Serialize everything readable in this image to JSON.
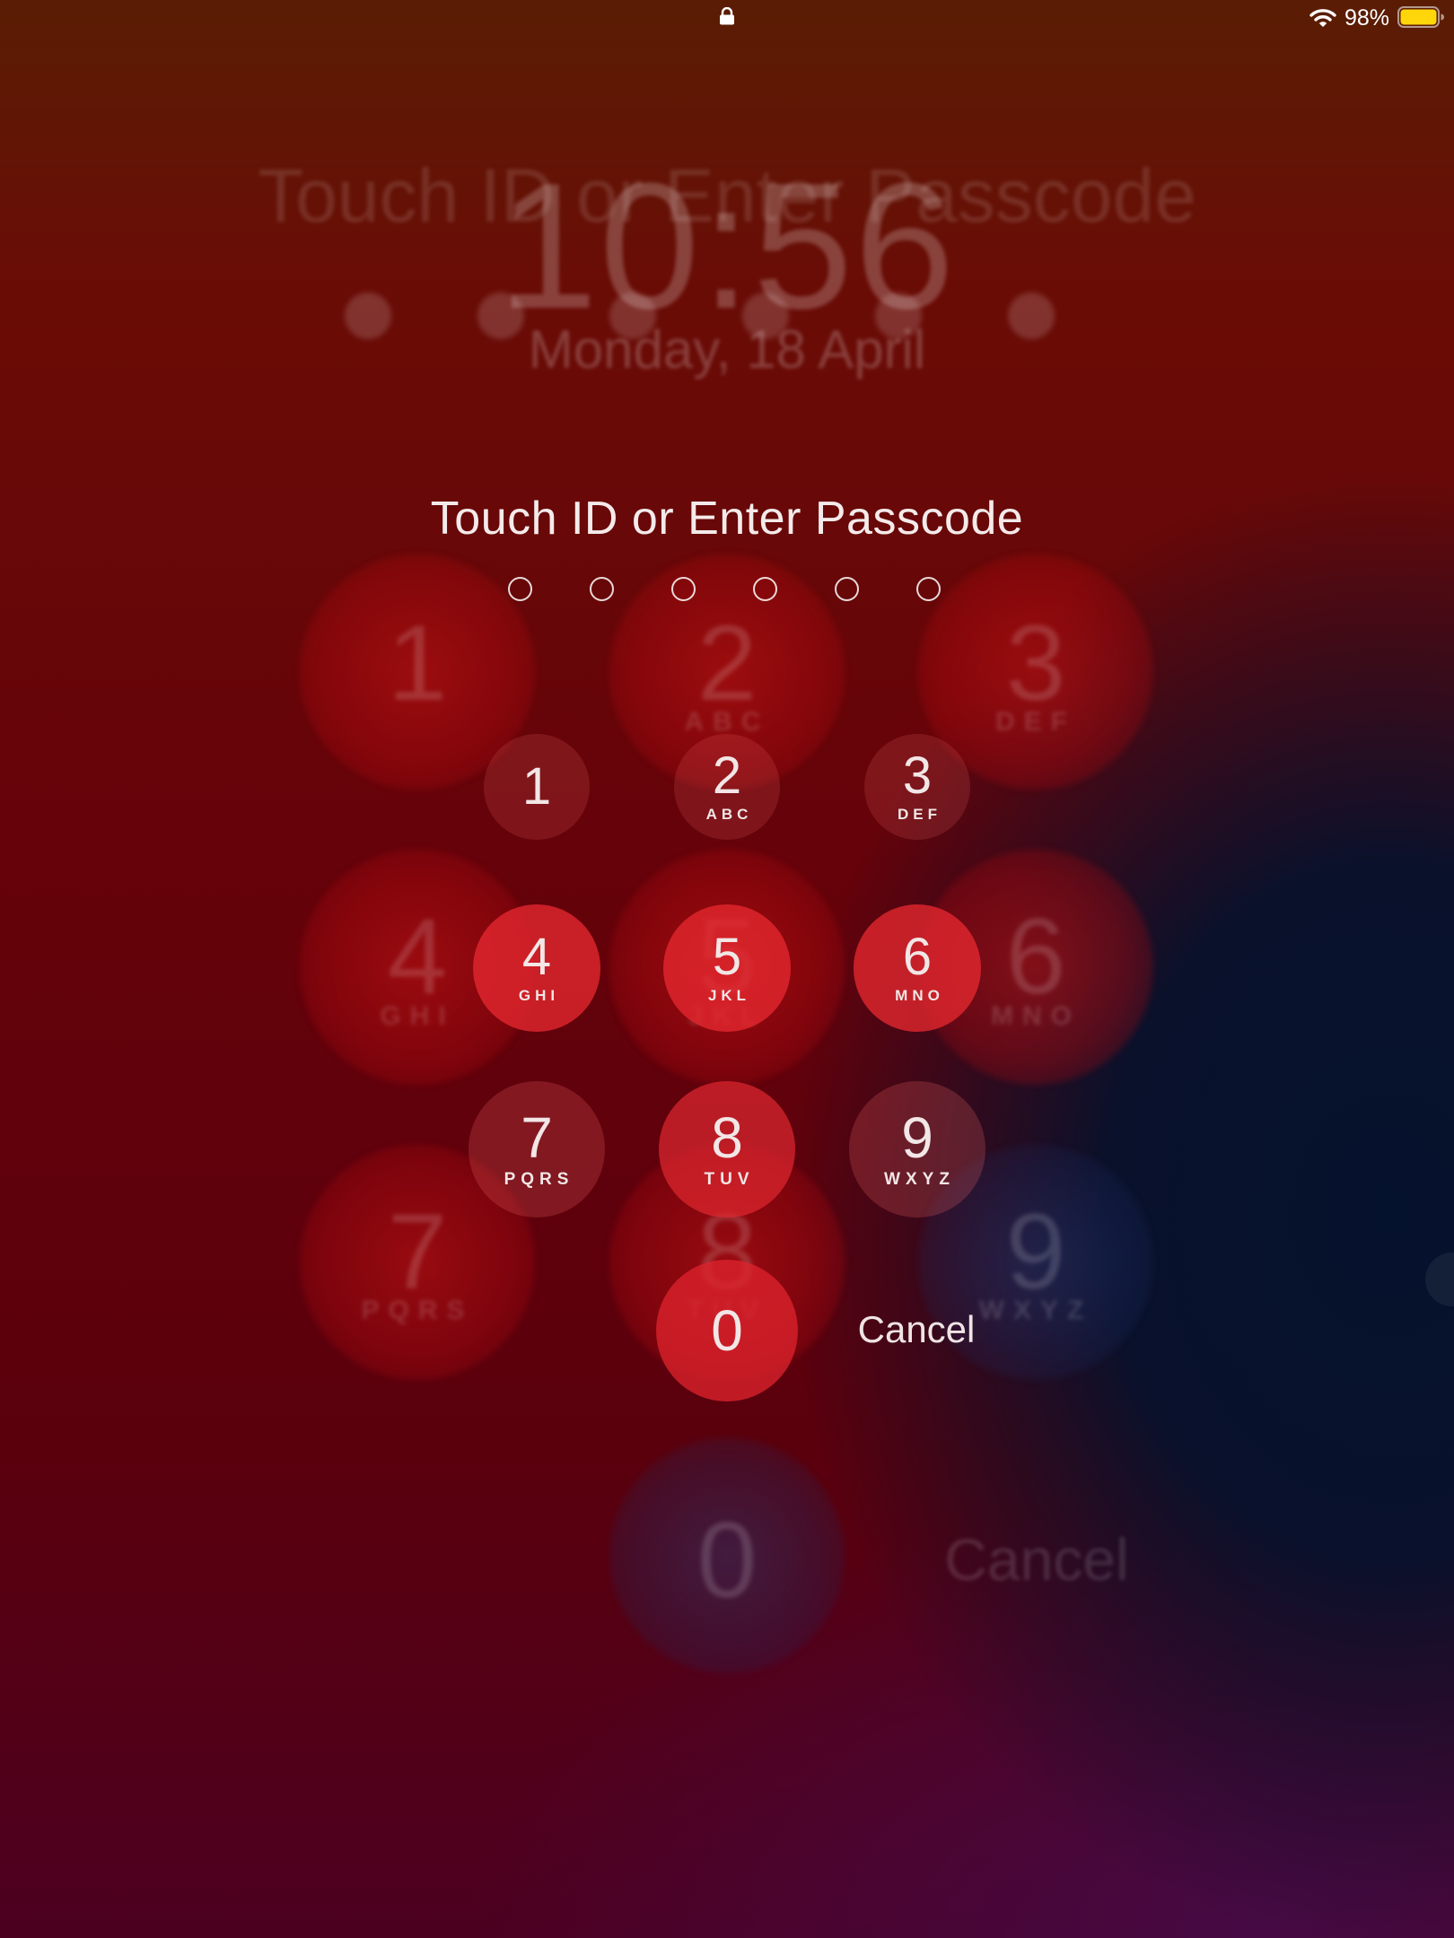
{
  "status_bar": {
    "battery_percent": "98%",
    "battery_color": "#ffd60a",
    "icons": [
      "lock-icon",
      "wifi-icon",
      "battery-icon"
    ]
  },
  "background_ghost": {
    "title": "Touch ID or Enter Passcode",
    "time": "10:56",
    "date": "Monday, 18 April",
    "keys": [
      {
        "num": "1",
        "letters": ""
      },
      {
        "num": "2",
        "letters": "ABC"
      },
      {
        "num": "3",
        "letters": "DEF"
      },
      {
        "num": "4",
        "letters": "GHI"
      },
      {
        "num": "5",
        "letters": "JKL"
      },
      {
        "num": "6",
        "letters": "MNO"
      },
      {
        "num": "7",
        "letters": "PQRS"
      },
      {
        "num": "8",
        "letters": "TUV"
      },
      {
        "num": "9",
        "letters": "WXYZ"
      },
      {
        "num": "0",
        "letters": ""
      }
    ],
    "cancel": "Cancel"
  },
  "passcode": {
    "title": "Touch ID or Enter Passcode",
    "digits_total": 6,
    "digits_entered": 0
  },
  "keypad": {
    "keys": [
      {
        "num": "1",
        "letters": ""
      },
      {
        "num": "2",
        "letters": "ABC"
      },
      {
        "num": "3",
        "letters": "DEF"
      },
      {
        "num": "4",
        "letters": "GHI"
      },
      {
        "num": "5",
        "letters": "JKL"
      },
      {
        "num": "6",
        "letters": "MNO"
      },
      {
        "num": "7",
        "letters": "PQRS"
      },
      {
        "num": "8",
        "letters": "TUV"
      },
      {
        "num": "9",
        "letters": "WXYZ"
      },
      {
        "num": "0",
        "letters": ""
      }
    ],
    "cancel_label": "Cancel"
  },
  "colors": {
    "key_highlight": "#e6282f",
    "background_red": "#65020a",
    "background_blue": "#05122d"
  }
}
